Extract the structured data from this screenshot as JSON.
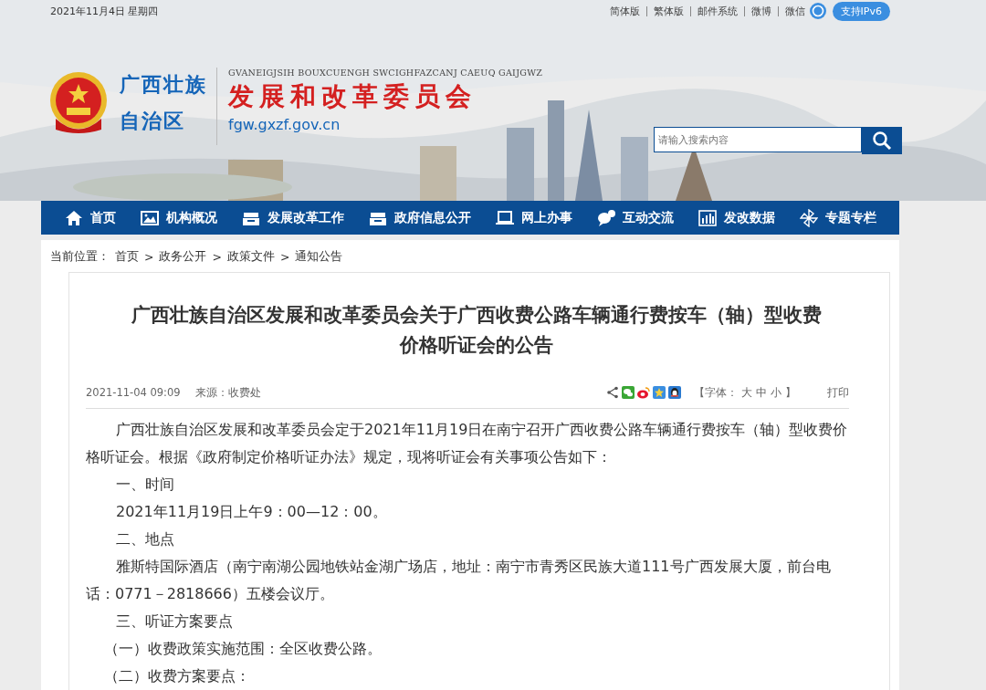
{
  "top_bar": {
    "date": "2021年11月4日  星期四",
    "links": [
      "简体版",
      "繁体版",
      "邮件系统",
      "微博",
      "微信"
    ],
    "ipv6_button": "支持IPv6"
  },
  "header": {
    "region_line1": "广西壮族",
    "region_line2": "自治区",
    "romanized_name": "GVANEIGJSIH BOUXCUENGH SWCIGHFAZCANJ CAEUQ GAIJGWZ",
    "agency_name": "发展和改革委员会",
    "site_url": "fgw.gxzf.gov.cn",
    "search": {
      "placeholder": "请输入搜索内容"
    }
  },
  "nav": [
    {
      "label": "首页"
    },
    {
      "label": "机构概况"
    },
    {
      "label": "发展改革工作"
    },
    {
      "label": "政府信息公开"
    },
    {
      "label": "网上办事"
    },
    {
      "label": "互动交流"
    },
    {
      "label": "发改数据"
    },
    {
      "label": "专题专栏"
    }
  ],
  "breadcrumb": {
    "label": "当前位置：",
    "items": [
      "首页",
      "政务公开",
      "政策文件",
      "通知公告"
    ],
    "separator": ">"
  },
  "article": {
    "title": "广西壮族自治区发展和改革委员会关于广西收费公路车辆通行费按车（轴）型收费价格听证会的公告",
    "date": "2021-11-04 09:09",
    "source": "来源：收费处",
    "font_label": "【字体：",
    "font_sizes": [
      "大",
      "中",
      "小"
    ],
    "font_close": "】",
    "print": "打印",
    "paragraphs": [
      {
        "kind": "indent",
        "text": "广西壮族自治区发展和改革委员会定于2021年11月19日在南宁召开广西收费公路车辆通行费按车（轴）型收费价格听证会。根据《政府制定价格听证办法》规定，现将听证会有关事项公告如下："
      },
      {
        "kind": "indent",
        "text": "一、时间"
      },
      {
        "kind": "indent",
        "text": "2021年11月19日上午9：00—12：00。"
      },
      {
        "kind": "indent",
        "text": "二、地点"
      },
      {
        "kind": "indent",
        "text": "雅斯特国际酒店（南宁南湖公园地铁站金湖广场店，地址：南宁市青秀区民族大道111号广西发展大厦，前台电话：0771－2818666）五楼会议厅。"
      },
      {
        "kind": "indent",
        "text": "三、听证方案要点"
      },
      {
        "kind": "sub",
        "text": "（一）收费政策实施范围：全区收费公路。"
      },
      {
        "kind": "sub",
        "text": "（二）收费方案要点："
      }
    ]
  }
}
